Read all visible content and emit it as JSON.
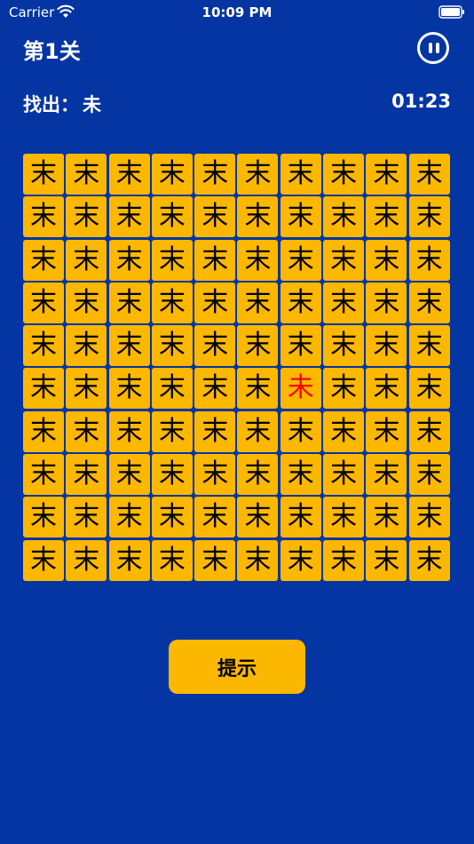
{
  "status_bar": {
    "carrier": "Carrier",
    "time": "10:09 PM",
    "wifi_icon": "wifi-icon",
    "battery_icon": "battery-icon"
  },
  "header": {
    "level_title": "第1关",
    "pause_icon": "pause-icon"
  },
  "info": {
    "find_label": "找出：",
    "target_char": "未",
    "timer": "01:23"
  },
  "grid": {
    "rows": 10,
    "cols": 10,
    "tile_char": "末",
    "odd_char": "未",
    "odd_row": 5,
    "odd_col": 6
  },
  "hint_button": {
    "label": "提示"
  },
  "colors": {
    "background": "#0435a2",
    "tile": "#fcb800",
    "tile_text": "#000000",
    "odd_text": "#ff0000",
    "header_text": "#ffffff"
  }
}
